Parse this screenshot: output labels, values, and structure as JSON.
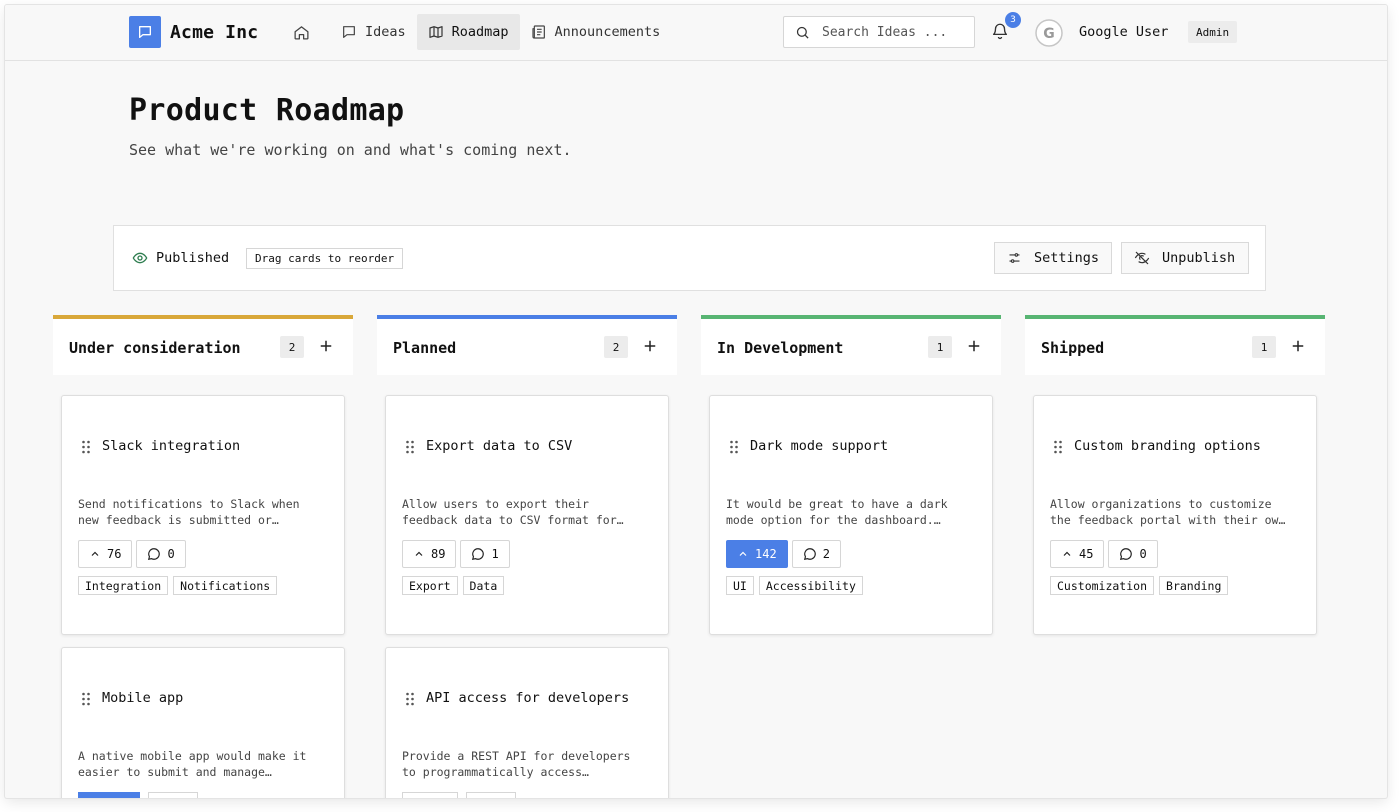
{
  "brand": {
    "name": "Acme Inc",
    "accent": "#4b7fe6"
  },
  "nav": {
    "home_icon": "home-icon",
    "items": [
      {
        "label": "Ideas",
        "icon": "message-square-icon"
      },
      {
        "label": "Roadmap",
        "icon": "map-icon",
        "active": true
      },
      {
        "label": "Announcements",
        "icon": "newspaper-icon"
      }
    ]
  },
  "search": {
    "placeholder": "Search Ideas ..."
  },
  "notifications": {
    "count": "3"
  },
  "user": {
    "initial": "G",
    "name": "Google User",
    "role": "Admin"
  },
  "page": {
    "title": "Product Roadmap",
    "subtitle": "See what we're working on and what's coming next."
  },
  "status": {
    "label": "Published",
    "hint": "Drag cards to reorder",
    "settings_label": "Settings",
    "unpublish_label": "Unpublish"
  },
  "columns": [
    {
      "title": "Under consideration",
      "count": "2",
      "color": "#d9a83a",
      "cards": [
        {
          "title": "Slack integration",
          "desc1": "Send notifications to Slack when",
          "desc2": "new feedback is submitted or…",
          "votes": "76",
          "voted": false,
          "comments": "0",
          "tags": [
            "Integration",
            "Notifications"
          ]
        },
        {
          "title": "Mobile app",
          "desc1": "A native mobile app would make it",
          "desc2": "easier to submit and manage…",
          "votes": "",
          "voted": true,
          "comments": "",
          "tags": []
        }
      ]
    },
    {
      "title": "Planned",
      "count": "2",
      "color": "#4b7fe6",
      "cards": [
        {
          "title": "Export data to CSV",
          "desc1": "Allow users to export their",
          "desc2": "feedback data to CSV format for…",
          "votes": "89",
          "voted": false,
          "comments": "1",
          "tags": [
            "Export",
            "Data"
          ]
        },
        {
          "title": "API access for developers",
          "desc1": "Provide a REST API for developers",
          "desc2": "to programmatically access…",
          "votes": "",
          "voted": false,
          "comments": "",
          "tags": []
        }
      ]
    },
    {
      "title": "In Development",
      "count": "1",
      "color": "#58b573",
      "cards": [
        {
          "title": "Dark mode support",
          "desc1": "It would be great to have a dark",
          "desc2": "mode option for the dashboard.…",
          "votes": "142",
          "voted": true,
          "comments": "2",
          "tags": [
            "UI",
            "Accessibility"
          ]
        }
      ]
    },
    {
      "title": "Shipped",
      "count": "1",
      "color": "#58b573",
      "cards": [
        {
          "title": "Custom branding options",
          "desc1": "Allow organizations to customize",
          "desc2": "the feedback portal with their ow…",
          "votes": "45",
          "voted": false,
          "comments": "0",
          "tags": [
            "Customization",
            "Branding"
          ]
        }
      ]
    }
  ]
}
